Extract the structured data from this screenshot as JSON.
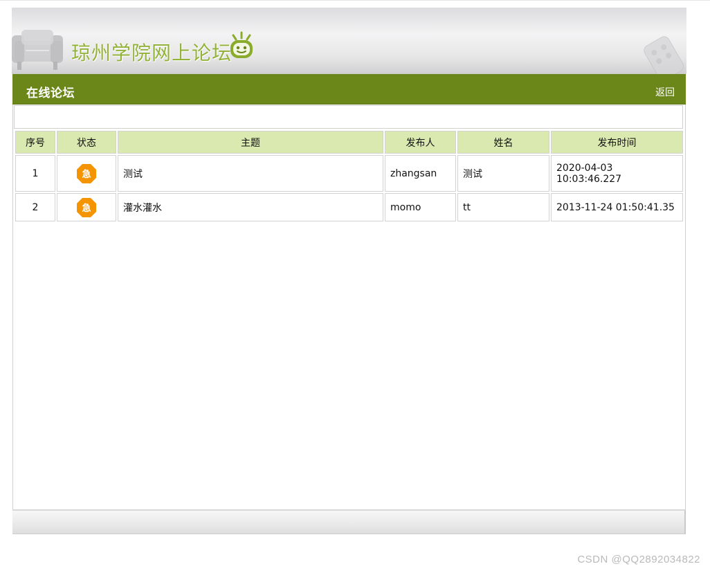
{
  "banner": {
    "site_title": "琼州学院网上论坛"
  },
  "header": {
    "title": "在线论坛",
    "back_label": "返回"
  },
  "table": {
    "columns": [
      "序号",
      "状态",
      "主题",
      "发布人",
      "姓名",
      "发布时间"
    ],
    "rows": [
      {
        "index": "1",
        "status_icon": "urgent-icon",
        "status_text": "急",
        "subject": "测试",
        "poster": "zhangsan",
        "name": "测试",
        "time": "2020-04-03 10:03:46.227"
      },
      {
        "index": "2",
        "status_icon": "urgent-icon",
        "status_text": "急",
        "subject": "灌水灌水",
        "poster": "momo",
        "name": "tt",
        "time": "2013-11-24 01:50:41.35"
      }
    ]
  },
  "watermark": "CSDN @QQ2892034822",
  "colors": {
    "header_green": "#6b8619",
    "title_green": "#93b23a",
    "table_header_bg": "#d9e9b0",
    "urgent_orange": "#f39400"
  }
}
